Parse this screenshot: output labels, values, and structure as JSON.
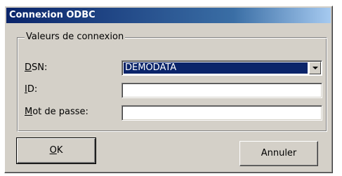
{
  "window": {
    "title": "Connexion ODBC"
  },
  "group": {
    "legend": "Valeurs de connexion",
    "dsn_label_key": "D",
    "dsn_label_rest": "SN:",
    "dsn_value": "DEMODATA",
    "id_label_key": "I",
    "id_label_rest": "D:",
    "id_value": "",
    "password_label_key": "M",
    "password_label_rest": "ot de passe:",
    "password_value": ""
  },
  "buttons": {
    "ok_key": "O",
    "ok_rest": "K",
    "cancel": "Annuler"
  },
  "icons": {
    "dropdown": "chevron-down-icon"
  }
}
